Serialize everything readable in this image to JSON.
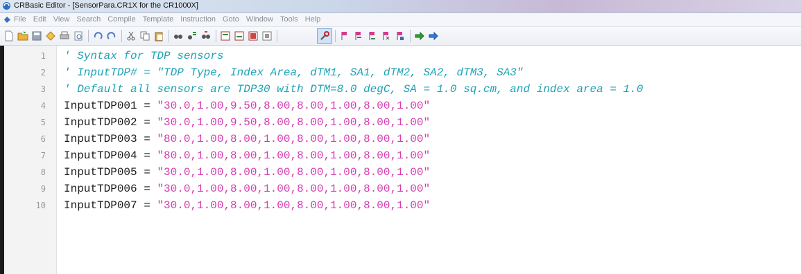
{
  "window": {
    "title": "CRBasic Editor - [SensorPara.CR1X for the CR1000X]"
  },
  "menu": {
    "items": [
      "File",
      "Edit",
      "View",
      "Search",
      "Compile",
      "Template",
      "Instruction",
      "Goto",
      "Window",
      "Tools",
      "Help"
    ]
  },
  "toolbar": {
    "icons": [
      "new-file-icon",
      "open-folder-icon",
      "save-icon",
      "compile-icon",
      "print-icon",
      "print-preview-icon",
      "undo-icon",
      "redo-icon",
      "cut-icon",
      "copy-icon",
      "paste-icon",
      "find-icon",
      "replace-icon",
      "find-next-icon",
      "bookmark-icon",
      "bookmark-next-icon",
      "bookmark-prev-icon",
      "bookmark-clear-icon",
      "wrench-icon",
      "flag-icon",
      "flag-next-icon",
      "flag-prev-icon",
      "flag-clear-icon",
      "flag-toggle-icon",
      "arrow-right-icon",
      "arrow-right-blue-icon"
    ]
  },
  "editor": {
    "lines": [
      {
        "num": "1",
        "comment": "' Syntax for TDP sensors"
      },
      {
        "num": "2",
        "comment": "' InputTDP# = \"TDP Type, Index Area, dTM1, SA1, dTM2, SA2, dTM3, SA3\""
      },
      {
        "num": "3",
        "comment": "' Default all sensors are TDP30 with DTM=8.0 degC, SA = 1.0 sq.cm, and index area = 1.0"
      },
      {
        "num": "4",
        "ident": "InputTDP001",
        "op": " = ",
        "str": "\"30.0,1.00,9.50,8.00,8.00,1.00,8.00,1.00\""
      },
      {
        "num": "5",
        "ident": "InputTDP002",
        "op": " = ",
        "str": "\"30.0,1.00,9.50,8.00,8.00,1.00,8.00,1.00\""
      },
      {
        "num": "6",
        "ident": "InputTDP003",
        "op": " = ",
        "str": "\"80.0,1.00,8.00,1.00,8.00,1.00,8.00,1.00\""
      },
      {
        "num": "7",
        "ident": "InputTDP004",
        "op": " = ",
        "str": "\"80.0,1.00,8.00,1.00,8.00,1.00,8.00,1.00\""
      },
      {
        "num": "8",
        "ident": "InputTDP005",
        "op": " = ",
        "str": "\"30.0,1.00,8.00,1.00,8.00,1.00,8.00,1.00\""
      },
      {
        "num": "9",
        "ident": "InputTDP006",
        "op": " = ",
        "str": "\"30.0,1.00,8.00,1.00,8.00,1.00,8.00,1.00\""
      },
      {
        "num": "10",
        "ident": "InputTDP007",
        "op": " = ",
        "str": "\"30.0,1.00,8.00,1.00,8.00,1.00,8.00,1.00\""
      }
    ]
  },
  "colors": {
    "comment": "#1fa3b6",
    "string": "#d63bb0",
    "identifier": "#1b1b1b",
    "line_number": "#9a9a9a"
  }
}
